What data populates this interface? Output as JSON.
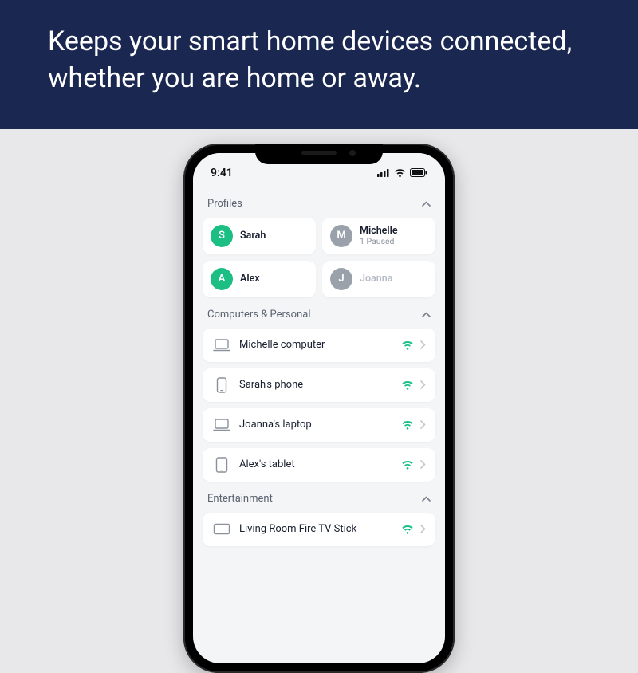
{
  "hero": {
    "headline": "Keeps your smart home devices connected, whether you are home or away."
  },
  "status": {
    "time": "9:41"
  },
  "sections": {
    "profiles_label": "Profiles",
    "computers_label": "Computers & Personal",
    "entertainment_label": "Entertainment"
  },
  "profiles": [
    {
      "initial": "S",
      "name": "Sarah",
      "sub": "",
      "color": "green",
      "active": true
    },
    {
      "initial": "M",
      "name": "Michelle",
      "sub": "1 Paused",
      "color": "grey",
      "active": true
    },
    {
      "initial": "A",
      "name": "Alex",
      "sub": "",
      "color": "green",
      "active": true
    },
    {
      "initial": "J",
      "name": "Joanna",
      "sub": "",
      "color": "grey",
      "active": false
    }
  ],
  "devices_personal": [
    {
      "icon": "laptop",
      "name": "Michelle computer"
    },
    {
      "icon": "phone",
      "name": "Sarah's phone"
    },
    {
      "icon": "laptop",
      "name": "Joanna's laptop"
    },
    {
      "icon": "tablet",
      "name": "Alex's tablet"
    }
  ],
  "devices_entertainment": [
    {
      "icon": "tv",
      "name": "Living Room Fire TV Stick"
    }
  ],
  "colors": {
    "accent": "#1bbf84",
    "navy": "#1a2750"
  }
}
